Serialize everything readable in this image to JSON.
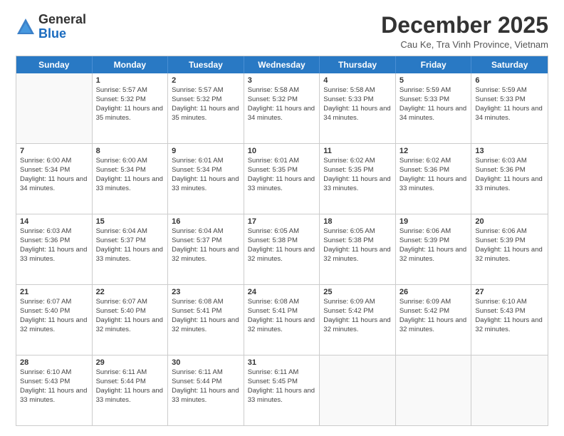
{
  "logo": {
    "general": "General",
    "blue": "Blue"
  },
  "header": {
    "month": "December 2025",
    "location": "Cau Ke, Tra Vinh Province, Vietnam"
  },
  "days": [
    "Sunday",
    "Monday",
    "Tuesday",
    "Wednesday",
    "Thursday",
    "Friday",
    "Saturday"
  ],
  "weeks": [
    [
      {
        "day": "",
        "sunrise": "",
        "sunset": "",
        "daylight": ""
      },
      {
        "day": "1",
        "sunrise": "Sunrise: 5:57 AM",
        "sunset": "Sunset: 5:32 PM",
        "daylight": "Daylight: 11 hours and 35 minutes."
      },
      {
        "day": "2",
        "sunrise": "Sunrise: 5:57 AM",
        "sunset": "Sunset: 5:32 PM",
        "daylight": "Daylight: 11 hours and 35 minutes."
      },
      {
        "day": "3",
        "sunrise": "Sunrise: 5:58 AM",
        "sunset": "Sunset: 5:32 PM",
        "daylight": "Daylight: 11 hours and 34 minutes."
      },
      {
        "day": "4",
        "sunrise": "Sunrise: 5:58 AM",
        "sunset": "Sunset: 5:33 PM",
        "daylight": "Daylight: 11 hours and 34 minutes."
      },
      {
        "day": "5",
        "sunrise": "Sunrise: 5:59 AM",
        "sunset": "Sunset: 5:33 PM",
        "daylight": "Daylight: 11 hours and 34 minutes."
      },
      {
        "day": "6",
        "sunrise": "Sunrise: 5:59 AM",
        "sunset": "Sunset: 5:33 PM",
        "daylight": "Daylight: 11 hours and 34 minutes."
      }
    ],
    [
      {
        "day": "7",
        "sunrise": "Sunrise: 6:00 AM",
        "sunset": "Sunset: 5:34 PM",
        "daylight": "Daylight: 11 hours and 34 minutes."
      },
      {
        "day": "8",
        "sunrise": "Sunrise: 6:00 AM",
        "sunset": "Sunset: 5:34 PM",
        "daylight": "Daylight: 11 hours and 33 minutes."
      },
      {
        "day": "9",
        "sunrise": "Sunrise: 6:01 AM",
        "sunset": "Sunset: 5:34 PM",
        "daylight": "Daylight: 11 hours and 33 minutes."
      },
      {
        "day": "10",
        "sunrise": "Sunrise: 6:01 AM",
        "sunset": "Sunset: 5:35 PM",
        "daylight": "Daylight: 11 hours and 33 minutes."
      },
      {
        "day": "11",
        "sunrise": "Sunrise: 6:02 AM",
        "sunset": "Sunset: 5:35 PM",
        "daylight": "Daylight: 11 hours and 33 minutes."
      },
      {
        "day": "12",
        "sunrise": "Sunrise: 6:02 AM",
        "sunset": "Sunset: 5:36 PM",
        "daylight": "Daylight: 11 hours and 33 minutes."
      },
      {
        "day": "13",
        "sunrise": "Sunrise: 6:03 AM",
        "sunset": "Sunset: 5:36 PM",
        "daylight": "Daylight: 11 hours and 33 minutes."
      }
    ],
    [
      {
        "day": "14",
        "sunrise": "Sunrise: 6:03 AM",
        "sunset": "Sunset: 5:36 PM",
        "daylight": "Daylight: 11 hours and 33 minutes."
      },
      {
        "day": "15",
        "sunrise": "Sunrise: 6:04 AM",
        "sunset": "Sunset: 5:37 PM",
        "daylight": "Daylight: 11 hours and 33 minutes."
      },
      {
        "day": "16",
        "sunrise": "Sunrise: 6:04 AM",
        "sunset": "Sunset: 5:37 PM",
        "daylight": "Daylight: 11 hours and 32 minutes."
      },
      {
        "day": "17",
        "sunrise": "Sunrise: 6:05 AM",
        "sunset": "Sunset: 5:38 PM",
        "daylight": "Daylight: 11 hours and 32 minutes."
      },
      {
        "day": "18",
        "sunrise": "Sunrise: 6:05 AM",
        "sunset": "Sunset: 5:38 PM",
        "daylight": "Daylight: 11 hours and 32 minutes."
      },
      {
        "day": "19",
        "sunrise": "Sunrise: 6:06 AM",
        "sunset": "Sunset: 5:39 PM",
        "daylight": "Daylight: 11 hours and 32 minutes."
      },
      {
        "day": "20",
        "sunrise": "Sunrise: 6:06 AM",
        "sunset": "Sunset: 5:39 PM",
        "daylight": "Daylight: 11 hours and 32 minutes."
      }
    ],
    [
      {
        "day": "21",
        "sunrise": "Sunrise: 6:07 AM",
        "sunset": "Sunset: 5:40 PM",
        "daylight": "Daylight: 11 hours and 32 minutes."
      },
      {
        "day": "22",
        "sunrise": "Sunrise: 6:07 AM",
        "sunset": "Sunset: 5:40 PM",
        "daylight": "Daylight: 11 hours and 32 minutes."
      },
      {
        "day": "23",
        "sunrise": "Sunrise: 6:08 AM",
        "sunset": "Sunset: 5:41 PM",
        "daylight": "Daylight: 11 hours and 32 minutes."
      },
      {
        "day": "24",
        "sunrise": "Sunrise: 6:08 AM",
        "sunset": "Sunset: 5:41 PM",
        "daylight": "Daylight: 11 hours and 32 minutes."
      },
      {
        "day": "25",
        "sunrise": "Sunrise: 6:09 AM",
        "sunset": "Sunset: 5:42 PM",
        "daylight": "Daylight: 11 hours and 32 minutes."
      },
      {
        "day": "26",
        "sunrise": "Sunrise: 6:09 AM",
        "sunset": "Sunset: 5:42 PM",
        "daylight": "Daylight: 11 hours and 32 minutes."
      },
      {
        "day": "27",
        "sunrise": "Sunrise: 6:10 AM",
        "sunset": "Sunset: 5:43 PM",
        "daylight": "Daylight: 11 hours and 32 minutes."
      }
    ],
    [
      {
        "day": "28",
        "sunrise": "Sunrise: 6:10 AM",
        "sunset": "Sunset: 5:43 PM",
        "daylight": "Daylight: 11 hours and 33 minutes."
      },
      {
        "day": "29",
        "sunrise": "Sunrise: 6:11 AM",
        "sunset": "Sunset: 5:44 PM",
        "daylight": "Daylight: 11 hours and 33 minutes."
      },
      {
        "day": "30",
        "sunrise": "Sunrise: 6:11 AM",
        "sunset": "Sunset: 5:44 PM",
        "daylight": "Daylight: 11 hours and 33 minutes."
      },
      {
        "day": "31",
        "sunrise": "Sunrise: 6:11 AM",
        "sunset": "Sunset: 5:45 PM",
        "daylight": "Daylight: 11 hours and 33 minutes."
      },
      {
        "day": "",
        "sunrise": "",
        "sunset": "",
        "daylight": ""
      },
      {
        "day": "",
        "sunrise": "",
        "sunset": "",
        "daylight": ""
      },
      {
        "day": "",
        "sunrise": "",
        "sunset": "",
        "daylight": ""
      }
    ]
  ]
}
